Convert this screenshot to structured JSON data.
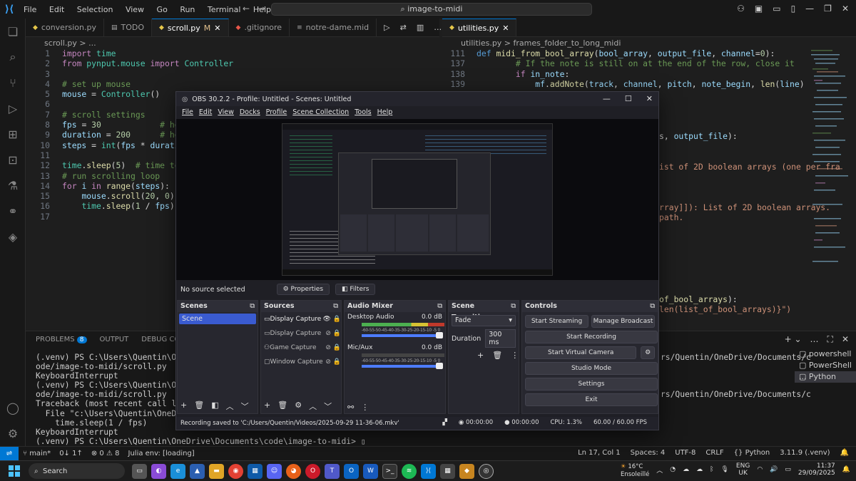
{
  "vscode": {
    "menu": [
      "File",
      "Edit",
      "Selection",
      "View",
      "Go",
      "Run",
      "Terminal",
      "Help"
    ],
    "search": "image-to-midi",
    "left_tabs": [
      {
        "label": "conversion.py",
        "icon": "python-icon"
      },
      {
        "label": "TODO",
        "icon": "file-icon"
      },
      {
        "label": "scroll.py",
        "suffix": "M",
        "icon": "python-icon",
        "active": true
      },
      {
        "label": ".gitignore",
        "icon": "git-icon"
      },
      {
        "label": "notre-dame.mid",
        "icon": "file-icon"
      }
    ],
    "right_tab": "utilities.py",
    "left_crumb": "scroll.py > ...",
    "right_crumb": "utilities.py > frames_folder_to_long_midi",
    "left_code_lines": [
      "1",
      "2",
      "3",
      "4",
      "5",
      "6",
      "7",
      "8",
      "9",
      "10",
      "11",
      "12",
      "13",
      "14",
      "15",
      "16",
      "17"
    ],
    "right_code_lines": [
      "111",
      "137",
      "138",
      "139"
    ],
    "panel_tabs": {
      "problems": "PROBLEMS",
      "problems_count": "8",
      "output": "OUTPUT",
      "debug": "DEBUG CONSOLE"
    },
    "terminals": [
      "powershell",
      "PowerShell ...",
      "Python"
    ],
    "terminal_lines": [
      "(.venv) PS C:\\Users\\Quentin\\OneDrive",
      "ode/image-to-midi/scroll.py",
      "KeyboardInterrupt",
      "(.venv) PS C:\\Users\\Quentin\\OneDrive",
      "ode/image-to-midi/scroll.py",
      "Traceback (most recent call last):",
      "  File \"c:\\Users\\Quentin\\OneDrive\\",
      "    time.sleep(1 / fps)",
      "KeyboardInterrupt",
      "(.venv) PS C:\\Users\\Quentin\\OneDrive\\Documents\\code\\image-to-midi> "
    ],
    "terminal_right_lines": [
      "rs/Quentin/OneDrive/Documents/c",
      "",
      "",
      "",
      "rs/Quentin/OneDrive/Documents/c"
    ],
    "status": {
      "branch": "main*",
      "sync": "0↓ 1↑",
      "errors": "0",
      "warnings": "8",
      "julia": "Julia env: [loading]",
      "position": "Ln 17, Col 1",
      "spaces": "Spaces: 4",
      "encoding": "UTF-8",
      "eol": "CRLF",
      "lang": "Python",
      "version": "3.11.9 (.venv)"
    }
  },
  "obs": {
    "title": "OBS 30.2.2 - Profile: Untitled - Scenes: Untitled",
    "menu": [
      "File",
      "Edit",
      "View",
      "Docks",
      "Profile",
      "Scene Collection",
      "Tools",
      "Help"
    ],
    "no_source": "No source selected",
    "properties": "Properties",
    "filters": "Filters",
    "scenes_title": "Scenes",
    "scenes": [
      "Scene"
    ],
    "sources_title": "Sources",
    "sources": [
      "Display Capture",
      "Display Capture",
      "Game Capture",
      "Window Capture"
    ],
    "mixer_title": "Audio Mixer",
    "tracks": [
      {
        "name": "Desktop Audio",
        "db": "0.0 dB"
      },
      {
        "name": "Mic/Aux",
        "db": "0.0 dB"
      }
    ],
    "meter_scale": "-60-55-50-45-40-35-30-25-20-15-10 -5  0",
    "transitions_title": "Scene Transitions",
    "transition": "Fade",
    "duration_label": "Duration",
    "duration": "300 ms",
    "controls_title": "Controls",
    "controls": {
      "streaming": "Start Streaming",
      "broadcast": "Manage Broadcast",
      "recording": "Start Recording",
      "virtual": "Start Virtual Camera",
      "studio": "Studio Mode",
      "settings": "Settings",
      "exit": "Exit"
    },
    "status_msg": "Recording saved to 'C:/Users/Quentin/Videos/2025-09-29 11-36-06.mkv'",
    "stream_time": "00:00:00",
    "rec_time": "00:00:00",
    "cpu": "CPU: 1.3%",
    "fps": "60.00 / 60.00 FPS"
  },
  "taskbar": {
    "search": "Search",
    "weather_temp": "16°C",
    "weather_desc": "Ensoleillé",
    "lang": "ENG",
    "region": "UK",
    "time": "11:37",
    "date": "29/09/2025"
  }
}
